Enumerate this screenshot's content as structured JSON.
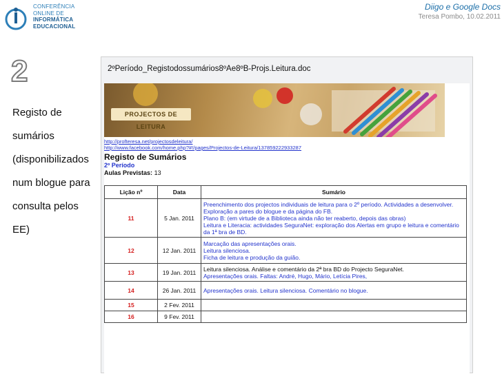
{
  "logo": {
    "lines": [
      "Conferência",
      "Online de",
      "Informática",
      "Educacional"
    ]
  },
  "header": {
    "title": "Diigo e Google Docs",
    "subtitle": "Teresa Pombo, 10.02.2011"
  },
  "slide_number": "2",
  "left_text": [
    "Registo de",
    "sumários",
    "(disponibilizados",
    "num blogue para",
    "consulta pelos",
    "EE)"
  ],
  "window_title": "2ºPeríodo_Registodossumários8ºAe8ºB-Projs.Leitura.doc",
  "doc": {
    "banner_label": "PROJECTOS DE LEITURA",
    "link1": "http://profteresa.net/projectosdeleitura/",
    "link2": "http://www.facebook.com/home.php?#!/pages/Projectos-de-Leitura/137859222933287",
    "title": "Registo de Sumários",
    "period": "2º Período",
    "aulas_label": "Aulas Previstas:",
    "aulas_value": "13",
    "table": {
      "headers": [
        "Lição nº",
        "Data",
        "Sumário"
      ],
      "rows": [
        {
          "num": "11",
          "date": "5 Jan. 2011",
          "lines": [
            "Preenchimento dos projectos individuais de leitura para o 2º período. Actividades a desenvolver. Exploração a pares do blogue e da página do FB.",
            "Plano B: (em virtude de a Biblioteca ainda não ter reaberto, depois das obras)",
            "Leitura e Literacia: actividades SeguraNet: exploração dos Alertas em grupo e leitura e comentário da 1ª bra de BD."
          ]
        },
        {
          "num": "12",
          "date": "12 Jan. 2011",
          "lines": [
            "Marcação das apresentações orais.",
            "Leitura silenciosa.",
            "Ficha de leitura e produção da guião."
          ]
        },
        {
          "num": "13",
          "date": "19 Jan. 2011",
          "lines": [
            "Leitura silenciosa. Análise e comentário da 2ª bra BD do Projecto SeguraNet.",
            "Apresentações orais. Faltas: André, Hugo, Mário, Letícia Pires,"
          ]
        },
        {
          "num": "14",
          "date": "26 Jan. 2011",
          "lines": [
            "Apresentações orais. Leitura silenciosa. Comentário no blogue."
          ]
        },
        {
          "num": "15",
          "date": "2 Fev. 2011",
          "lines": []
        },
        {
          "num": "16",
          "date": "9 Fev. 2011",
          "lines": []
        }
      ]
    }
  },
  "colors": {
    "accent": "#1b6ea8",
    "lesson_number": "#d41c1c",
    "link": "#2233cc"
  }
}
